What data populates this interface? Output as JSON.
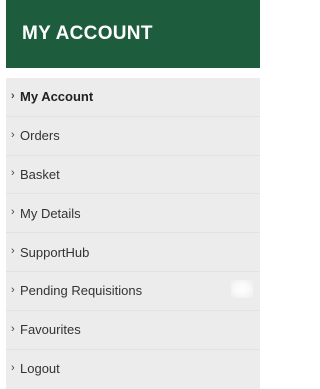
{
  "header": {
    "title": "MY ACCOUNT"
  },
  "menu": {
    "items": [
      {
        "label": "My Account",
        "chevron": "›",
        "active": true
      },
      {
        "label": "Orders",
        "chevron": "›"
      },
      {
        "label": "Basket",
        "chevron": "›"
      },
      {
        "label": "My Details",
        "chevron": "›"
      },
      {
        "label": "SupportHub",
        "chevron": "›"
      },
      {
        "label": "Pending Requisitions",
        "chevron": "›"
      },
      {
        "label": "Favourites",
        "chevron": "›"
      },
      {
        "label": "Logout",
        "chevron": "›"
      }
    ]
  },
  "colors": {
    "header_bg": "#1d5c3d",
    "menu_bg": "#ececec",
    "divider": "#e2e2e2",
    "text": "#333333"
  }
}
